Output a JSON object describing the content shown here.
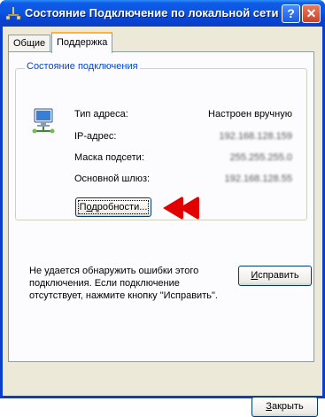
{
  "window": {
    "title": "Состояние Подключение по локальной сети",
    "help_label": "?",
    "close_label": "✕"
  },
  "tabs": [
    {
      "label": "Общие"
    },
    {
      "label": "Поддержка"
    }
  ],
  "status_group": {
    "title": "Состояние подключения",
    "rows": [
      {
        "label": "Тип адреса:",
        "value": "Настроен вручную"
      },
      {
        "label": "IP-адрес:",
        "value": "192.168.128.159"
      },
      {
        "label": "Маска подсети:",
        "value": "255.255.255.0"
      },
      {
        "label": "Основной шлюз:",
        "value": "192.168.128.55"
      }
    ],
    "details_button": {
      "prefix": "П",
      "underlined": "о",
      "rest": "дробности..."
    }
  },
  "message": "Не удается обнаружить ошибки этого подключения. Если подключение отсутствует, нажмите кнопку \"Исправить\".",
  "repair_button": {
    "underlined": "И",
    "rest": "справить"
  },
  "close_button": {
    "underlined": "З",
    "rest": "акрыть"
  },
  "colors": {
    "title_bar": "#0a55e3",
    "group_title": "#0046d5",
    "arrow": "#e00000"
  }
}
